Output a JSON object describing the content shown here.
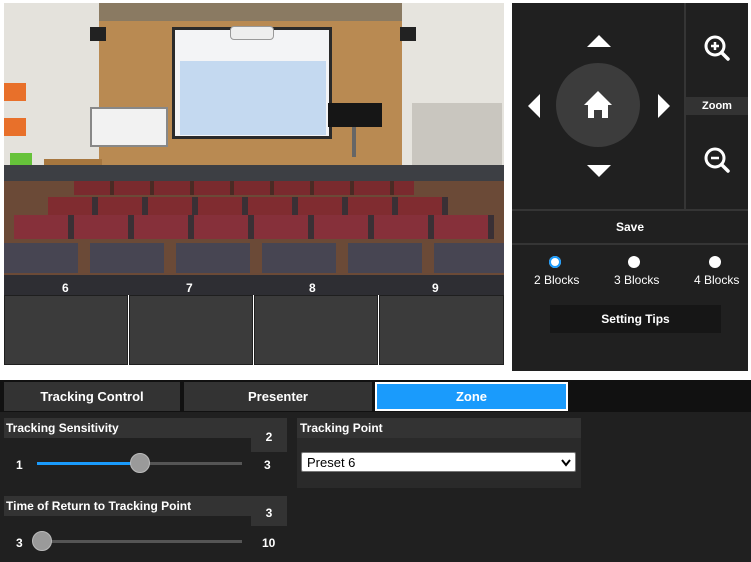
{
  "zone_cells": [
    {
      "number": "6"
    },
    {
      "number": "7"
    },
    {
      "number": "8"
    },
    {
      "number": "9"
    }
  ],
  "ptz": {
    "up_icon": "arrow-up-icon",
    "down_icon": "arrow-down-icon",
    "left_icon": "arrow-left-icon",
    "right_icon": "arrow-right-icon",
    "home_icon": "home-icon",
    "zoom_in_icon": "zoom-in-icon",
    "zoom_out_icon": "zoom-out-icon",
    "zoom_label": "Zoom",
    "save_label": "Save",
    "blocks": [
      {
        "label": "2 Blocks",
        "selected": true
      },
      {
        "label": "3 Blocks",
        "selected": false
      },
      {
        "label": "4 Blocks",
        "selected": false
      }
    ],
    "setting_tips_label": "Setting Tips"
  },
  "tabs": [
    {
      "label": "Tracking Control",
      "active": false
    },
    {
      "label": "Presenter",
      "active": false
    },
    {
      "label": "Zone",
      "active": true
    }
  ],
  "sensitivity": {
    "title": "Tracking Sensitivity",
    "value": "2",
    "min": "1",
    "max": "3",
    "level_fraction": 0.5
  },
  "tracking_point": {
    "title": "Tracking Point",
    "selected": "Preset 6"
  },
  "return_time": {
    "title": "Time of Return to Tracking Point",
    "value": "3",
    "min": "3",
    "max": "10",
    "level_fraction": 0.0
  },
  "colors": {
    "accent": "#1a9bfc",
    "panel": "#202020",
    "header": "#333333"
  }
}
